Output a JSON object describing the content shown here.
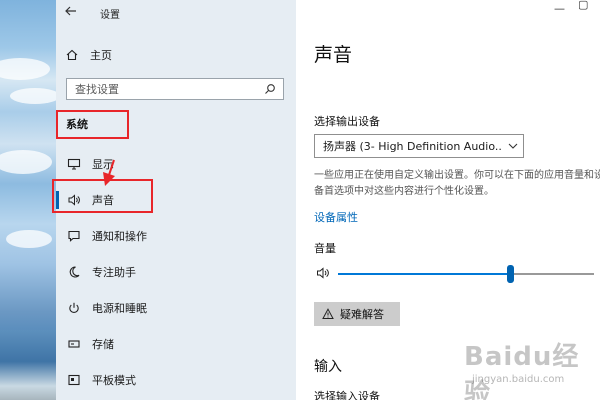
{
  "window": {
    "title": "设置"
  },
  "nav": {
    "home_label": "主页",
    "search_placeholder": "查找设置",
    "section_label": "系统",
    "items": [
      {
        "label": "显示",
        "icon": "monitor-icon",
        "active": false
      },
      {
        "label": "声音",
        "icon": "speaker-icon",
        "active": true
      },
      {
        "label": "通知和操作",
        "icon": "notification-icon",
        "active": false
      },
      {
        "label": "专注助手",
        "icon": "moon-icon",
        "active": false
      },
      {
        "label": "电源和睡眠",
        "icon": "power-icon",
        "active": false
      },
      {
        "label": "存储",
        "icon": "storage-icon",
        "active": false
      },
      {
        "label": "平板模式",
        "icon": "tablet-mode-icon",
        "active": false
      }
    ]
  },
  "main": {
    "title": "声音",
    "output_device_label": "选择输出设备",
    "output_device_value": "扬声器 (3- High Definition Audio...",
    "output_description": "一些应用正在使用自定义输出设置。你可以在下面的应用音量和设备首选项中对这些内容进行个性化设置。",
    "device_properties_link": "设备属性",
    "volume_label": "音量",
    "volume_level": 0.67,
    "troubleshoot_label": "疑难解答",
    "input_heading": "输入",
    "input_device_label": "选择输入设备"
  },
  "watermark": {
    "brand": "Baidu经验",
    "url": "jingyan.baidu.com"
  },
  "colors": {
    "accent": "#0063b1",
    "link": "#0067b8",
    "highlight": "#e8262a",
    "nav_bg": "#e6edf3"
  }
}
